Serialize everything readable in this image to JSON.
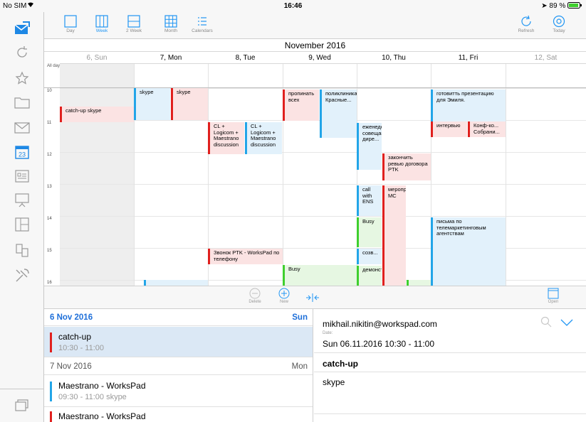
{
  "status": {
    "carrier": "No SIM",
    "time": "16:46",
    "battery": "89 %"
  },
  "toolbar": {
    "views": [
      {
        "label": "Day",
        "icon": "day-view-icon",
        "active": false
      },
      {
        "label": "Week",
        "icon": "week-view-icon",
        "active": true
      },
      {
        "label": "2 Week",
        "icon": "two-week-view-icon",
        "active": false
      },
      {
        "label": "Month",
        "icon": "month-view-icon",
        "active": false
      },
      {
        "label": "Calendars",
        "icon": "calendars-list-icon",
        "active": false
      }
    ],
    "refresh_label": "Refresh",
    "today_label": "Today"
  },
  "calendar": {
    "month_title": "November 2016",
    "allday_label": "All day",
    "days": [
      {
        "label": "6, Sun",
        "weekend": true
      },
      {
        "label": "7, Mon",
        "weekend": false
      },
      {
        "label": "8, Tue",
        "weekend": false
      },
      {
        "label": "9, Wed",
        "weekend": false
      },
      {
        "label": "10, Thu",
        "weekend": false
      },
      {
        "label": "11, Fri",
        "weekend": false
      },
      {
        "label": "12, Sat",
        "weekend": true
      }
    ],
    "hours": [
      "10",
      "11",
      "12",
      "13",
      "14",
      "15",
      "16"
    ],
    "events": [
      {
        "text": "catch-up skype",
        "color": "red",
        "day": 0
      },
      {
        "text": "skype",
        "color": "blue",
        "day": 1
      },
      {
        "text": "skype",
        "color": "red",
        "day": 1
      },
      {
        "text": "CL + Logicom + Maestrano discussion",
        "color": "red",
        "day": 2
      },
      {
        "text": "CL + Logicom + Maestrano discussion",
        "color": "blue",
        "day": 2
      },
      {
        "text": "Звонок PTK - WorksPad по телефону",
        "color": "red",
        "day": 2
      },
      {
        "text": "пропинать всех",
        "color": "red",
        "day": 3
      },
      {
        "text": "поликлиника Красные...",
        "color": "blue",
        "day": 3
      },
      {
        "text": "Busy",
        "color": "green",
        "day": 3
      },
      {
        "text": "еженедельное совещание... дире...",
        "color": "blue",
        "day": 4
      },
      {
        "text": "закончить ревью договора PTK",
        "color": "red",
        "day": 4
      },
      {
        "text": "call with ENS",
        "color": "blue",
        "day": 4
      },
      {
        "text": "мероприятие МС",
        "color": "red",
        "day": 4
      },
      {
        "text": "Busy",
        "color": "green",
        "day": 4
      },
      {
        "text": "созв...",
        "color": "blue",
        "day": 4
      },
      {
        "text": "демонстраци",
        "color": "green",
        "day": 4
      },
      {
        "text": "готовитть презентацию для Эмиля.",
        "color": "blue",
        "day": 5
      },
      {
        "text": "интервью",
        "color": "red",
        "day": 5
      },
      {
        "text": "Конф-ко... Собрани...",
        "color": "red",
        "day": 5
      },
      {
        "text": "письма по телемаркетинговым агентствам",
        "color": "blue",
        "day": 5
      }
    ]
  },
  "actions": {
    "delete_label": "Delete",
    "new_label": "New",
    "open_label": "Open"
  },
  "agenda": [
    {
      "date": "6 Nov 2016",
      "weekday": "Sun",
      "highlight": true,
      "items": [
        {
          "title": "catch-up",
          "time": "10:30 - 11:00",
          "color": "#e0201e",
          "selected": true
        }
      ]
    },
    {
      "date": "7 Nov 2016",
      "weekday": "Mon",
      "highlight": false,
      "items": [
        {
          "title": "Maestrano - WorksPad",
          "time": "09:30 - 11:00  skype",
          "color": "#22a5e8",
          "selected": false
        },
        {
          "title": "Maestrano - WorksPad",
          "time": "",
          "color": "#e0201e",
          "selected": false
        }
      ]
    }
  ],
  "detail": {
    "account": "mikhail.nikitin@workspad.com",
    "date_label": "Date:",
    "date_value": "Sun 06.11.2016 10:30 - 11:00",
    "title": "catch-up",
    "location": "skype"
  },
  "colors": {
    "accent": "#2196f3",
    "red": "#e0201e",
    "blue": "#22a5e8",
    "green": "#3fcf2e"
  }
}
